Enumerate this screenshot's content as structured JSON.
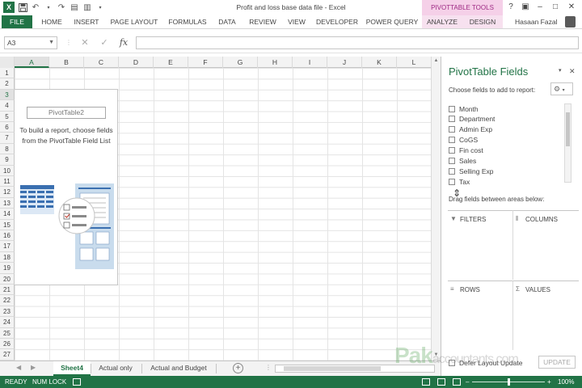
{
  "app": {
    "window_title": "Profit and loss base data file - Excel",
    "contextual_tab_group": "PIVOTTABLE TOOLS",
    "user_name": "Hasaan Fazal"
  },
  "ribbon": {
    "tabs": [
      "FILE",
      "HOME",
      "INSERT",
      "PAGE LAYOUT",
      "FORMULAS",
      "DATA",
      "REVIEW",
      "VIEW",
      "DEVELOPER",
      "POWER QUERY",
      "ANALYZE",
      "DESIGN"
    ]
  },
  "formula_bar": {
    "name_box": "A3",
    "fx_label": "fx",
    "value": ""
  },
  "grid": {
    "columns": [
      "A",
      "B",
      "C",
      "D",
      "E",
      "F",
      "G",
      "H",
      "I",
      "J",
      "K",
      "L"
    ],
    "rows": [
      "1",
      "2",
      "3",
      "4",
      "5",
      "6",
      "7",
      "8",
      "9",
      "10",
      "11",
      "12",
      "13",
      "14",
      "15",
      "16",
      "17",
      "18",
      "19",
      "20",
      "21",
      "22",
      "23",
      "24",
      "25",
      "26",
      "27"
    ],
    "selected_column": "A",
    "selected_row": "3"
  },
  "pivot_placeholder": {
    "name": "PivotTable2",
    "instructions": "To build a report, choose fields from the PivotTable Field List"
  },
  "sheets": {
    "tabs": [
      "Sheet4",
      "Actual only",
      "Actual and Budget"
    ],
    "active": "Sheet4"
  },
  "task_pane": {
    "title": "PivotTable Fields",
    "subtitle": "Choose fields to add to report:",
    "fields": [
      "Month",
      "Department",
      "Admin Exp",
      "CoGS",
      "Fin cost",
      "Sales",
      "Selling Exp",
      "Tax"
    ],
    "drag_label": "Drag fields between areas below:",
    "areas": {
      "filters": "FILTERS",
      "columns": "COLUMNS",
      "rows": "ROWS",
      "values": "VALUES"
    },
    "defer_label": "Defer Layout Update",
    "update_button": "UPDATE"
  },
  "status_bar": {
    "ready": "READY",
    "num_lock": "NUM LOCK",
    "zoom": "100%"
  },
  "watermark": {
    "brand": "Pak",
    "rest": "accountants.com"
  },
  "colors": {
    "excel_green": "#217346",
    "pivot_pink": "#9e2a84"
  }
}
